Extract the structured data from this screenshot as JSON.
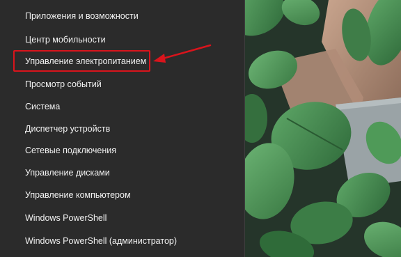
{
  "menu": {
    "items": [
      {
        "label": "Приложения и возможности"
      },
      {
        "label": "Центр мобильности"
      },
      {
        "label": "Управление электропитанием"
      },
      {
        "label": "Просмотр событий"
      },
      {
        "label": "Система"
      },
      {
        "label": "Диспетчер устройств"
      },
      {
        "label": "Сетевые подключения"
      },
      {
        "label": "Управление дисками"
      },
      {
        "label": "Управление компьютером"
      },
      {
        "label": "Windows PowerShell"
      },
      {
        "label": "Windows PowerShell (администратор)"
      }
    ],
    "highlighted_index": 2
  },
  "colors": {
    "menu_background": "#2b2b2b",
    "menu_text": "#f2f2f2",
    "annotation_red": "#d9141c",
    "leaf_green": "#4a8a50"
  },
  "icons": {
    "annotation_arrow": "red-arrow-icon"
  }
}
